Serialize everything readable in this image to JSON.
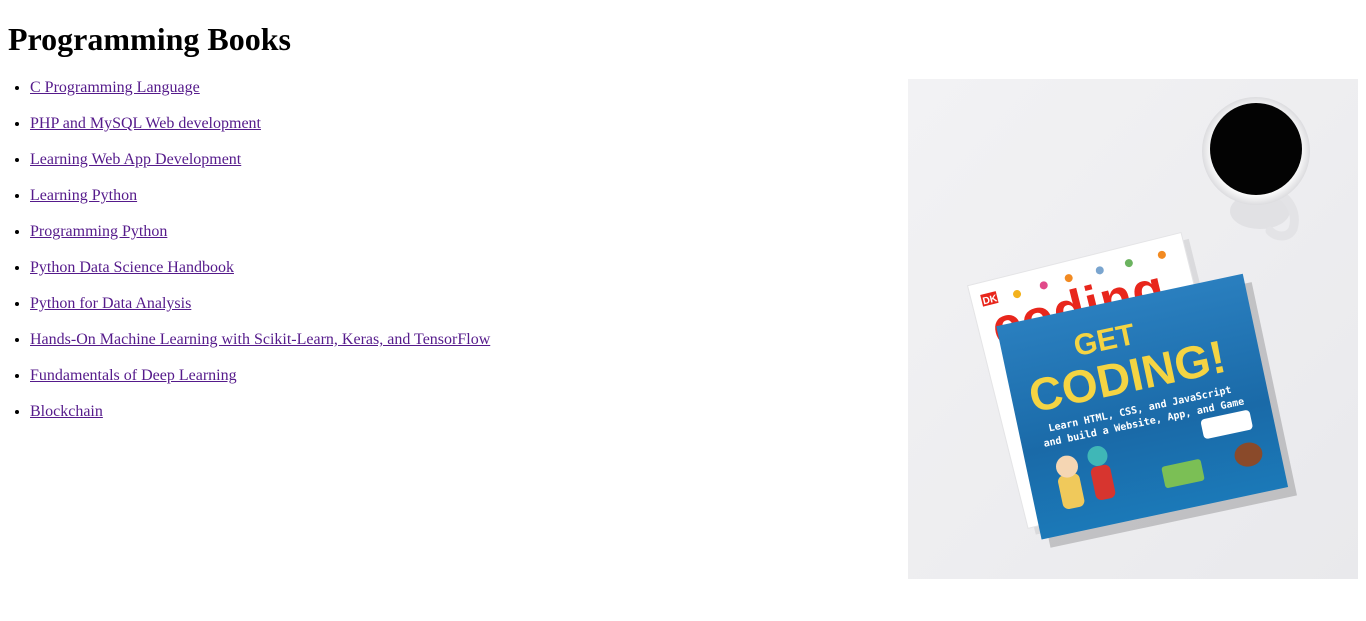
{
  "page": {
    "title": "Programming Books"
  },
  "books": [
    {
      "label": "C Programming Language"
    },
    {
      "label": "PHP and MySQL Web development"
    },
    {
      "label": "Learning Web App Development"
    },
    {
      "label": "Learning Python"
    },
    {
      "label": "Programming Python"
    },
    {
      "label": "Python Data Science Handbook"
    },
    {
      "label": "Python for Data Analysis"
    },
    {
      "label": "Hands-On Machine Learning with Scikit-Learn, Keras, and TensorFlow"
    },
    {
      "label": "Fundamentals of Deep Learning"
    },
    {
      "label": "Blockchain"
    }
  ],
  "hero_image": {
    "back_book": {
      "publisher": "DK",
      "title": "coding"
    },
    "front_book": {
      "title_line1": "GET",
      "title_line2": "CODING!",
      "subtitle_line1": "Learn HTML, CSS, and JavaScript",
      "subtitle_line2": "and build a Website, App, and Game"
    },
    "colors": {
      "background": "#eeeef0",
      "front_cover": "#1f6fb0",
      "title_yellow": "#f4d443",
      "back_title_red": "#e8261c",
      "coffee": "#050505"
    }
  },
  "link_color": "#551a8b"
}
